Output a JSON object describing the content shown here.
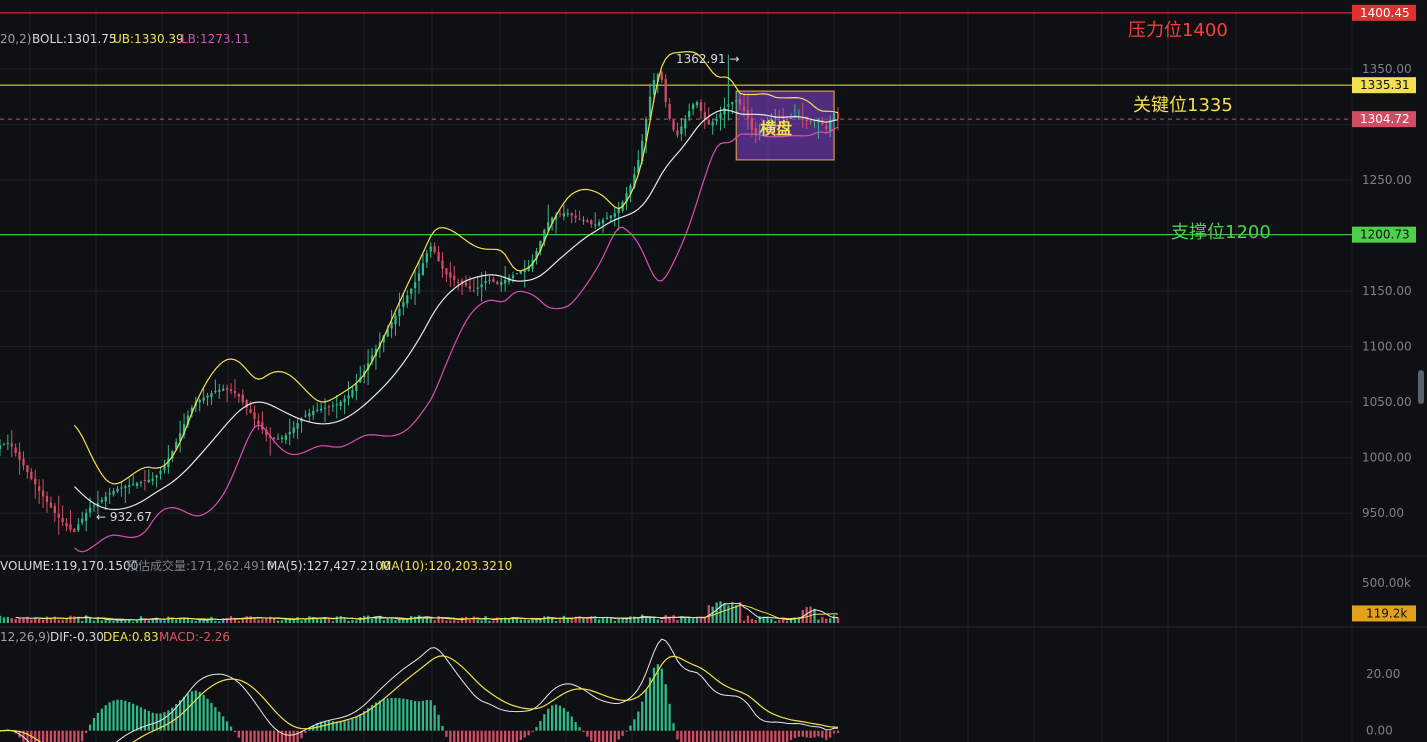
{
  "colors": {
    "background": "#0f1014",
    "grid": "#1d2026",
    "text": "#b7bcc3",
    "muted": "#7b818a",
    "up": "#32b987",
    "down": "#d24d63",
    "boll_mid": "#e8e8e8",
    "boll_ub": "#f3e04d",
    "boll_lb": "#d94eb5",
    "resistance": "#ff3b3b",
    "key": "#f3e04d",
    "support": "#4dd14d",
    "box_fill": "#7b3fc4",
    "box_stroke": "#f0ad44"
  },
  "toolbar": {
    "buttons": [
      "crosshair",
      "trend-line",
      "ray",
      "hline",
      "text",
      "measure",
      "eraser",
      "settings",
      "screenshot"
    ]
  },
  "legend": {
    "boll": {
      "param": "20,2)",
      "mid_label": "BOLL:1301.75",
      "ub_label": "UB:1330.39",
      "lb_label": "LB:1273.11"
    },
    "volume": {
      "label": "VOLUME:119,170.1500",
      "est_label": "预估成交量:171,262.4910",
      "ma5_label": "MA(5):127,427.2100",
      "ma10_label": "MA(10):120,203.3210"
    },
    "macd": {
      "param": "12,26,9)",
      "dif_label": "DIF:-0.30",
      "dea_label": "DEA:0.83",
      "macd_label": "MACD:-2.26"
    }
  },
  "annotations": {
    "high_label": "1362.91 →",
    "low_label": "← 932.67",
    "box_label": "横盘",
    "resistance_label": "压力位1400",
    "key_label": "关键位1335",
    "support_label": "支撑位1200"
  },
  "axis_tags": {
    "resistance": "1400.45",
    "key": "1335.31",
    "current": "1304.72",
    "support": "1200.73",
    "volume": "119.2k"
  },
  "axis_ticks": {
    "price": [
      "1350.00",
      "1250.00",
      "1150.00",
      "1100.00",
      "1050.00",
      "1000.00",
      "950.00"
    ],
    "volume": [
      "500.00k"
    ],
    "macd": [
      "20.00",
      "0.00"
    ]
  },
  "chart_data": {
    "type": "candlestick",
    "price_range": [
      915,
      1403
    ],
    "volume_range": [
      0,
      600000
    ],
    "macd_range": [
      -4,
      30
    ],
    "levels": {
      "resistance": 1400.45,
      "key": 1335.31,
      "current": 1304.72,
      "support": 1200.73
    },
    "high": 1362.91,
    "low": 932.67,
    "consolidation_box": {
      "price_range": [
        1268,
        1330
      ],
      "start_index": 188,
      "end_index": 213
    },
    "close": [
      1011,
      1012,
      1013,
      1010,
      1004,
      998,
      993,
      987,
      981,
      976,
      970,
      965,
      960,
      955,
      950,
      946,
      942,
      938,
      935,
      933,
      940,
      945,
      950,
      955,
      957,
      959,
      962,
      965,
      968,
      970,
      972,
      973,
      974,
      975,
      976,
      977,
      978,
      979,
      980,
      981,
      984,
      988,
      993,
      999,
      1006,
      1014,
      1022,
      1030,
      1038,
      1045,
      1050,
      1052,
      1054,
      1056,
      1058,
      1060,
      1061,
      1062,
      1061,
      1060,
      1058,
      1055,
      1050,
      1045,
      1040,
      1035,
      1030,
      1025,
      1020,
      1018,
      1017,
      1017,
      1018,
      1020,
      1023,
      1027,
      1031,
      1035,
      1038,
      1040,
      1042,
      1043,
      1044,
      1045,
      1046,
      1047,
      1048,
      1050,
      1053,
      1056,
      1061,
      1066,
      1072,
      1078,
      1085,
      1092,
      1098,
      1104,
      1110,
      1116,
      1122,
      1128,
      1134,
      1140,
      1146,
      1152,
      1158,
      1166,
      1175,
      1184,
      1190,
      1185,
      1177,
      1170,
      1165,
      1162,
      1160,
      1158,
      1156,
      1155,
      1152,
      1150,
      1153,
      1156,
      1159,
      1160,
      1158,
      1156,
      1158,
      1160,
      1162,
      1164,
      1166,
      1168,
      1170,
      1172,
      1178,
      1186,
      1195,
      1205,
      1212,
      1216,
      1218,
      1219,
      1220,
      1220,
      1218,
      1216,
      1215,
      1214,
      1212,
      1210,
      1210,
      1212,
      1214,
      1216,
      1218,
      1220,
      1224,
      1230,
      1238,
      1245,
      1255,
      1268,
      1285,
      1305,
      1325,
      1340,
      1345,
      1340,
      1320,
      1305,
      1295,
      1290,
      1298,
      1305,
      1312,
      1318,
      1320,
      1312,
      1305,
      1300,
      1302,
      1305,
      1310,
      1315,
      1318,
      1320,
      1322,
      1318,
      1312,
      1305,
      1295,
      1290,
      1294,
      1298,
      1302,
      1305,
      1307,
      1306,
      1305,
      1304,
      1306,
      1308,
      1307,
      1305,
      1303,
      1302,
      1304,
      1305,
      1300,
      1296,
      1304,
      1310,
      1305
    ],
    "boll": {
      "mid": "20-period moving average of close",
      "ub": "mid + 2 standard deviations",
      "lb": "mid - 2 standard deviations"
    },
    "volume": "per-candle traded volume",
    "macd": "DIF = EMA12 - EMA26, DEA = EMA9 of DIF, histogram = DIF - DEA"
  }
}
